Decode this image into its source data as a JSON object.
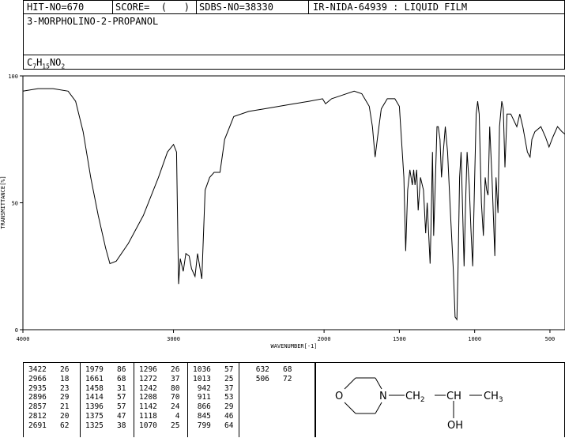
{
  "header": {
    "hit_no": "HIT-NO=670",
    "score": "SCORE=  (   )",
    "sdbs_no": "SDBS-NO=38330",
    "ir_info": "IR-NIDA-64939 : LIQUID FILM"
  },
  "compound_name": "3-MORPHOLINO-2-PROPANOL",
  "formula": {
    "base": "C",
    "c": "7",
    "h_label": "H",
    "h": "15",
    "rest": "NO",
    "o": "2"
  },
  "chart_data": {
    "type": "line",
    "xlabel": "WAVENUMBER[-1]",
    "ylabel": "TRANSMITTANCE[%]",
    "xlim": [
      4000,
      400
    ],
    "ylim": [
      0,
      100
    ],
    "x_ticks": [
      "4000",
      "3000",
      "2000",
      "1500",
      "1000",
      "500"
    ],
    "x_tick_values": [
      4000,
      3000,
      2000,
      1500,
      1000,
      500
    ],
    "y_ticks": [
      "0",
      "50",
      "100"
    ],
    "y_tick_values": [
      0,
      50,
      100
    ],
    "series": [
      {
        "points": [
          [
            4000,
            94
          ],
          [
            3900,
            95
          ],
          [
            3800,
            95
          ],
          [
            3700,
            94
          ],
          [
            3650,
            90
          ],
          [
            3600,
            78
          ],
          [
            3550,
            60
          ],
          [
            3500,
            45
          ],
          [
            3450,
            32
          ],
          [
            3422,
            26
          ],
          [
            3380,
            27
          ],
          [
            3300,
            34
          ],
          [
            3200,
            45
          ],
          [
            3100,
            60
          ],
          [
            3040,
            70
          ],
          [
            3000,
            73
          ],
          [
            2980,
            70
          ],
          [
            2966,
            18
          ],
          [
            2955,
            28
          ],
          [
            2935,
            23
          ],
          [
            2918,
            30
          ],
          [
            2896,
            29
          ],
          [
            2880,
            24
          ],
          [
            2857,
            21
          ],
          [
            2840,
            30
          ],
          [
            2812,
            20
          ],
          [
            2790,
            55
          ],
          [
            2760,
            60
          ],
          [
            2730,
            62
          ],
          [
            2691,
            62
          ],
          [
            2660,
            75
          ],
          [
            2600,
            84
          ],
          [
            2500,
            86
          ],
          [
            2400,
            87
          ],
          [
            2300,
            88
          ],
          [
            2200,
            89
          ],
          [
            2100,
            90
          ],
          [
            2010,
            91
          ],
          [
            1990,
            89
          ],
          [
            1950,
            91
          ],
          [
            1900,
            92
          ],
          [
            1800,
            94
          ],
          [
            1750,
            93
          ],
          [
            1700,
            88
          ],
          [
            1679,
            80
          ],
          [
            1661,
            68
          ],
          [
            1640,
            78
          ],
          [
            1620,
            87
          ],
          [
            1580,
            91
          ],
          [
            1530,
            91
          ],
          [
            1500,
            88
          ],
          [
            1470,
            60
          ],
          [
            1458,
            31
          ],
          [
            1445,
            55
          ],
          [
            1430,
            63
          ],
          [
            1414,
            57
          ],
          [
            1405,
            63
          ],
          [
            1396,
            57
          ],
          [
            1385,
            63
          ],
          [
            1375,
            47
          ],
          [
            1360,
            60
          ],
          [
            1340,
            55
          ],
          [
            1325,
            38
          ],
          [
            1315,
            50
          ],
          [
            1296,
            26
          ],
          [
            1290,
            40
          ],
          [
            1280,
            70
          ],
          [
            1272,
            37
          ],
          [
            1260,
            60
          ],
          [
            1250,
            80
          ],
          [
            1242,
            80
          ],
          [
            1230,
            75
          ],
          [
            1220,
            60
          ],
          [
            1208,
            70
          ],
          [
            1195,
            80
          ],
          [
            1180,
            70
          ],
          [
            1160,
            45
          ],
          [
            1142,
            24
          ],
          [
            1130,
            5
          ],
          [
            1118,
            4
          ],
          [
            1110,
            25
          ],
          [
            1100,
            60
          ],
          [
            1090,
            70
          ],
          [
            1070,
            25
          ],
          [
            1060,
            50
          ],
          [
            1050,
            70
          ],
          [
            1036,
            57
          ],
          [
            1025,
            40
          ],
          [
            1013,
            25
          ],
          [
            1000,
            60
          ],
          [
            990,
            85
          ],
          [
            980,
            90
          ],
          [
            970,
            85
          ],
          [
            955,
            50
          ],
          [
            942,
            37
          ],
          [
            930,
            60
          ],
          [
            920,
            55
          ],
          [
            911,
            53
          ],
          [
            900,
            80
          ],
          [
            885,
            60
          ],
          [
            866,
            29
          ],
          [
            858,
            60
          ],
          [
            845,
            46
          ],
          [
            835,
            80
          ],
          [
            820,
            90
          ],
          [
            810,
            87
          ],
          [
            799,
            64
          ],
          [
            785,
            85
          ],
          [
            760,
            85
          ],
          [
            720,
            80
          ],
          [
            700,
            85
          ],
          [
            680,
            80
          ],
          [
            650,
            70
          ],
          [
            632,
            68
          ],
          [
            620,
            75
          ],
          [
            600,
            78
          ],
          [
            560,
            80
          ],
          [
            530,
            76
          ],
          [
            506,
            72
          ],
          [
            480,
            76
          ],
          [
            450,
            80
          ],
          [
            420,
            78
          ],
          [
            400,
            77
          ]
        ]
      }
    ]
  },
  "peak_table": [
    [
      [
        "3422",
        "26"
      ],
      [
        "2966",
        "18"
      ],
      [
        "2935",
        "23"
      ],
      [
        "2896",
        "29"
      ],
      [
        "2857",
        "21"
      ],
      [
        "2812",
        "20"
      ],
      [
        "2691",
        "62"
      ]
    ],
    [
      [
        "1979",
        "86"
      ],
      [
        "1661",
        "68"
      ],
      [
        "1458",
        "31"
      ],
      [
        "1414",
        "57"
      ],
      [
        "1396",
        "57"
      ],
      [
        "1375",
        "47"
      ],
      [
        "1325",
        "38"
      ]
    ],
    [
      [
        "1296",
        "26"
      ],
      [
        "1272",
        "37"
      ],
      [
        "1242",
        "80"
      ],
      [
        "1208",
        "70"
      ],
      [
        "1142",
        "24"
      ],
      [
        "1118",
        "4"
      ],
      [
        "1070",
        "25"
      ]
    ],
    [
      [
        "1036",
        "57"
      ],
      [
        "1013",
        "25"
      ],
      [
        "942",
        "37"
      ],
      [
        "911",
        "53"
      ],
      [
        "866",
        "29"
      ],
      [
        "845",
        "46"
      ],
      [
        "799",
        "64"
      ]
    ],
    [
      [
        "632",
        "68"
      ],
      [
        "506",
        "72"
      ]
    ]
  ],
  "structure": {
    "o": "O",
    "n": "N",
    "ch2": "CH2",
    "ch": "CH",
    "ch3": "CH3",
    "oh": "OH"
  }
}
